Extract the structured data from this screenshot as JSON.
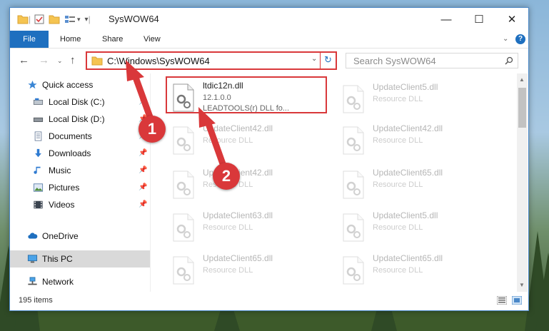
{
  "window": {
    "title": "SysWOW64",
    "controls": {
      "minimize": "—",
      "maximize": "☐",
      "close": "✕"
    }
  },
  "ribbon": {
    "tabs": [
      "File",
      "Home",
      "Share",
      "View"
    ],
    "expand_icon": "chevron-down-icon",
    "help_icon": "help-icon"
  },
  "address": {
    "path": "C:\\Windows\\SysWOW64",
    "search_placeholder": "Search SysWOW64"
  },
  "nav": {
    "items": [
      {
        "label": "Quick access",
        "icon": "star-icon"
      },
      {
        "label": "Local Disk (C:)",
        "icon": "drive-icon",
        "pinned": true
      },
      {
        "label": "Local Disk (D:)",
        "icon": "drive-icon",
        "pinned": true
      },
      {
        "label": "Documents",
        "icon": "documents-icon",
        "pinned": true
      },
      {
        "label": "Downloads",
        "icon": "downloads-icon",
        "pinned": true
      },
      {
        "label": "Music",
        "icon": "music-icon",
        "pinned": true
      },
      {
        "label": "Pictures",
        "icon": "pictures-icon",
        "pinned": true
      },
      {
        "label": "Videos",
        "icon": "videos-icon",
        "pinned": true
      },
      {
        "label": "OneDrive",
        "icon": "cloud-icon"
      },
      {
        "label": "This PC",
        "icon": "computer-icon",
        "selected": true
      },
      {
        "label": "Network",
        "icon": "network-icon"
      }
    ]
  },
  "files": {
    "left": [
      {
        "name": "ltdic12n.dll",
        "line2": "12.1.0.0",
        "line3": "LEADTOOLS(r) DLL fo..."
      },
      {
        "name": "UpdateClient42.dll",
        "line2": "Resource DLL"
      },
      {
        "name": "UpdateClient42.dll",
        "line2": "Resource DLL"
      },
      {
        "name": "UpdateClient63.dll",
        "line2": "Resource DLL"
      },
      {
        "name": "UpdateClient65.dll",
        "line2": "Resource DLL"
      }
    ],
    "right": [
      {
        "name": "UpdateClient5.dll",
        "line2": "Resource DLL"
      },
      {
        "name": "UpdateClient42.dll",
        "line2": "Resource DLL"
      },
      {
        "name": "UpdateClient65.dll",
        "line2": "Resource DLL"
      },
      {
        "name": "UpdateClient5.dll",
        "line2": "Resource DLL"
      },
      {
        "name": "UpdateClient65.dll",
        "line2": "Resource DLL"
      }
    ]
  },
  "status": {
    "item_count": "195 items"
  },
  "callouts": [
    "1",
    "2"
  ],
  "colors": {
    "accent": "#1e6fbf",
    "highlight": "#d9383a"
  }
}
